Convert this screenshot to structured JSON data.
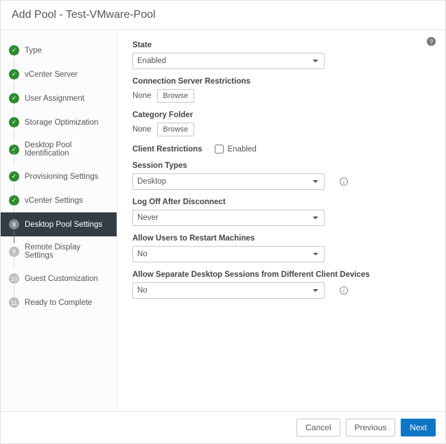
{
  "header": {
    "title": "Add Pool - Test-VMware-Pool"
  },
  "sidebar": {
    "steps": [
      {
        "label": "Type",
        "status": "done",
        "num": "✓"
      },
      {
        "label": "vCenter Server",
        "status": "done",
        "num": "✓"
      },
      {
        "label": "User Assignment",
        "status": "done",
        "num": "✓"
      },
      {
        "label": "Storage Optimization",
        "status": "done",
        "num": "✓"
      },
      {
        "label": "Desktop Pool Identification",
        "status": "done",
        "num": "✓"
      },
      {
        "label": "Provisioning Settings",
        "status": "done",
        "num": "✓"
      },
      {
        "label": "vCenter Settings",
        "status": "done",
        "num": "✓"
      },
      {
        "label": "Desktop Pool Settings",
        "status": "active",
        "num": "8"
      },
      {
        "label": "Remote Display Settings",
        "status": "pending",
        "num": "9"
      },
      {
        "label": "Guest Customization",
        "status": "pending",
        "num": "10"
      },
      {
        "label": "Ready to Complete",
        "status": "pending",
        "num": "11"
      }
    ]
  },
  "form": {
    "state": {
      "label": "State",
      "value": "Enabled"
    },
    "connServer": {
      "label": "Connection Server Restrictions",
      "value": "None",
      "browse": "Browse"
    },
    "categoryFolder": {
      "label": "Category Folder",
      "value": "None",
      "browse": "Browse"
    },
    "clientRestrictions": {
      "label": "Client Restrictions",
      "checkboxLabel": "Enabled"
    },
    "sessionTypes": {
      "label": "Session Types",
      "value": "Desktop"
    },
    "logOff": {
      "label": "Log Off After Disconnect",
      "value": "Never"
    },
    "allowRestart": {
      "label": "Allow Users to Restart Machines",
      "value": "No"
    },
    "allowSeparate": {
      "label": "Allow Separate Desktop Sessions from Different Client Devices",
      "value": "No"
    }
  },
  "footer": {
    "cancel": "Cancel",
    "previous": "Previous",
    "next": "Next"
  }
}
